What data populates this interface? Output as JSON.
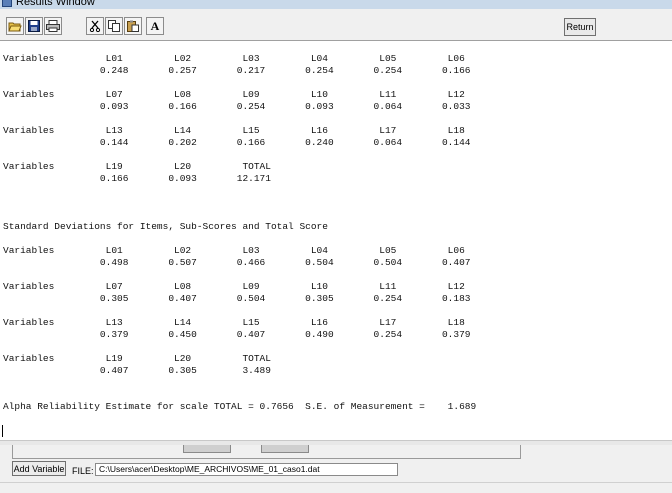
{
  "window": {
    "title": "Results Window"
  },
  "toolbar": {
    "icons": [
      "open-folder-icon",
      "save-icon",
      "print-icon",
      "cut-icon",
      "copy-icon",
      "paste-icon",
      "font-icon"
    ],
    "font_glyph": "A",
    "return_label": "Return"
  },
  "results": {
    "means_blocks": [
      "Variables         L01         L02         L03         L04         L05         L06\n                 0.248       0.257       0.217       0.254       0.254       0.166",
      "Variables         L07         L08         L09         L10         L11         L12\n                 0.093       0.166       0.254       0.093       0.064       0.033",
      "Variables         L13         L14         L15         L16         L17         L18\n                 0.144       0.202       0.166       0.240       0.064       0.144",
      "Variables         L19         L20         TOTAL\n                 0.166       0.093       12.171"
    ],
    "sd_heading": "Standard Deviations for Items, Sub-Scores and Total Score",
    "sd_blocks": [
      "Variables         L01         L02         L03         L04         L05         L06\n                 0.498       0.507       0.466       0.504       0.504       0.407",
      "Variables         L07         L08         L09         L10         L11         L12\n                 0.305       0.407       0.504       0.305       0.254       0.183",
      "Variables         L13         L14         L15         L16         L17         L18\n                 0.379       0.450       0.407       0.490       0.254       0.379",
      "Variables         L19         L20         TOTAL\n                 0.407       0.305        3.489"
    ],
    "alpha_line": "Alpha Reliability Estimate for scale TOTAL = 0.7656  S.E. of Measurement =    1.689"
  },
  "bottom": {
    "add_variable_label": "Add Variable",
    "file_label": "FILE:",
    "file_path": "C:\\Users\\acer\\Desktop\\ME_ARCHIVOS\\ME_01_caso1.dat"
  }
}
